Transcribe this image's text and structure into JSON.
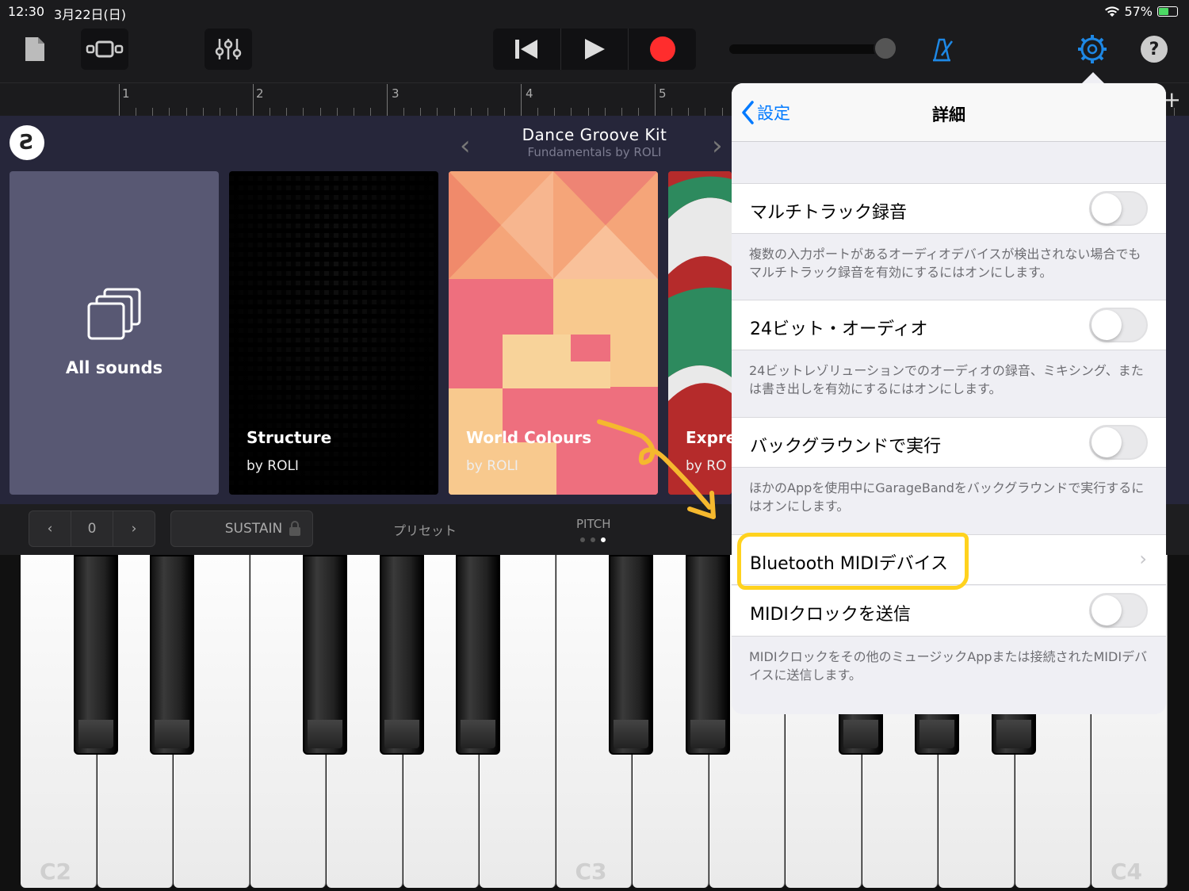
{
  "status": {
    "time": "12:30",
    "date": "3月22日(日)",
    "battery": "57%",
    "battery_level": 0.57
  },
  "toolbar": {
    "buttons": [
      "document-icon",
      "tracks-view-icon",
      "mixer-icon",
      "rewind-icon",
      "play-icon",
      "record-icon",
      "metronome-icon",
      "settings-gear-icon",
      "help-icon"
    ],
    "help_label": "?",
    "accent_color": "#1e88e5",
    "record_color": "#ff2d2d"
  },
  "ruler": {
    "bars": [
      "1",
      "2",
      "3",
      "4",
      "5"
    ],
    "add_label": "+"
  },
  "browser": {
    "logo": "Ƨ",
    "kit_title": "Dance Groove Kit",
    "kit_subtitle": "Fundamentals by ROLI",
    "cards": [
      {
        "name": "All sounds",
        "by": ""
      },
      {
        "name": "Structure",
        "by": "by ROLI"
      },
      {
        "name": "World Colours",
        "by": "by ROLI"
      },
      {
        "name": "Expre",
        "by": "by RO"
      }
    ]
  },
  "keyboard_controls": {
    "octave_value": "0",
    "sustain_label": "SUSTAIN",
    "preset_label": "プリセット",
    "pitch_label": "PITCH",
    "page_dots_active": 3
  },
  "piano": {
    "labels": [
      "C2",
      "C3",
      "C4"
    ]
  },
  "settings_popover": {
    "back_label": "設定",
    "title": "詳細",
    "rows": [
      {
        "label": "マルチトラック録音",
        "type": "toggle",
        "on": false
      },
      {
        "label": "24ビット・オーディオ",
        "type": "toggle",
        "on": false
      },
      {
        "label": "バックグラウンドで実行",
        "type": "toggle",
        "on": false
      },
      {
        "label": "Bluetooth MIDIデバイス",
        "type": "link"
      },
      {
        "label": "MIDIクロックを送信",
        "type": "toggle",
        "on": false
      }
    ],
    "notes": [
      "複数の入力ポートがあるオーディオデバイスが検出されない場合でもマルチトラック録音を有効にするにはオンにします。",
      "24ビットレゾリューションでのオーディオの録音、ミキシング、または書き出しを有効にするにはオンにします。",
      "ほかのAppを使用中にGarageBandをバックグラウンドで実行するにはオンにします。",
      "MIDIクロックをその他のミュージックAppまたは接続されたMIDIデバイスに送信します。"
    ],
    "highlight_color": "#ffd21e"
  }
}
